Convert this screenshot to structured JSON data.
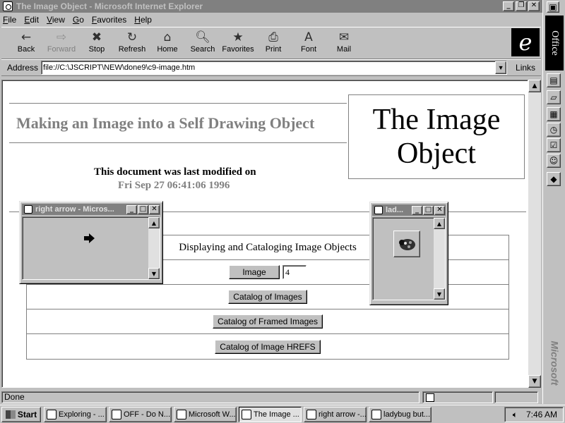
{
  "window": {
    "title": "The Image Object - Microsoft Internet Explorer",
    "min_glyph": "_",
    "max_glyph": "❐",
    "close_glyph": "✕"
  },
  "menu": [
    "File",
    "Edit",
    "View",
    "Go",
    "Favorites",
    "Help"
  ],
  "toolbar": [
    {
      "label": "Back",
      "icon": "←",
      "enabled": true
    },
    {
      "label": "Forward",
      "icon": "⇨",
      "enabled": false
    },
    {
      "label": "Stop",
      "icon": "✖",
      "enabled": true
    },
    {
      "label": "Refresh",
      "icon": "↻",
      "enabled": true
    },
    {
      "label": "Home",
      "icon": "⌂",
      "enabled": true
    },
    {
      "label": "Search",
      "icon": "🔍︎",
      "enabled": true
    },
    {
      "label": "Favorites",
      "icon": "★",
      "enabled": true
    },
    {
      "label": "Print",
      "icon": "⎙",
      "enabled": true
    },
    {
      "label": "Font",
      "icon": "A",
      "enabled": true
    },
    {
      "label": "Mail",
      "icon": "✉",
      "enabled": true
    }
  ],
  "ie_logo": "e",
  "address": {
    "label": "Address",
    "value": "file://C:\\JSCRIPT\\NEW\\done9\\c9-image.htm",
    "links_label": "Links"
  },
  "page": {
    "heading": "Making an Image into a Self Drawing Object",
    "big_title": "The Image Object",
    "modified_label": "This document was last modified on",
    "modified_date": "Fri Sep 27 06:41:06 1996",
    "table_title": "Displaying and Cataloging Image Objects",
    "image_button": "Image",
    "image_count": "4",
    "catalog_button": "Catalog of Images",
    "framed_button": "Catalog of Framed Images",
    "hrefs_button": "Catalog of Image HREFS"
  },
  "popups": {
    "arrow_title": "right arrow - Micros...",
    "lady_title": "lad..."
  },
  "status": {
    "text": "Done"
  },
  "officebar": {
    "logo": "Office",
    "brand": "Microsoft"
  },
  "taskbar": {
    "start": "Start",
    "tasks": [
      {
        "label": "Exploring - ...",
        "active": false
      },
      {
        "label": "OFF - Do N...",
        "active": false
      },
      {
        "label": "Microsoft W...",
        "active": false
      },
      {
        "label": "The Image ...",
        "active": true
      },
      {
        "label": "right arrow -...",
        "active": false
      },
      {
        "label": "ladybug but...",
        "active": false
      }
    ],
    "clock": "7:46 AM"
  },
  "colors": {
    "face": "#c0c0c0",
    "inactive_title": "#808080",
    "heading_gray": "#808080"
  }
}
